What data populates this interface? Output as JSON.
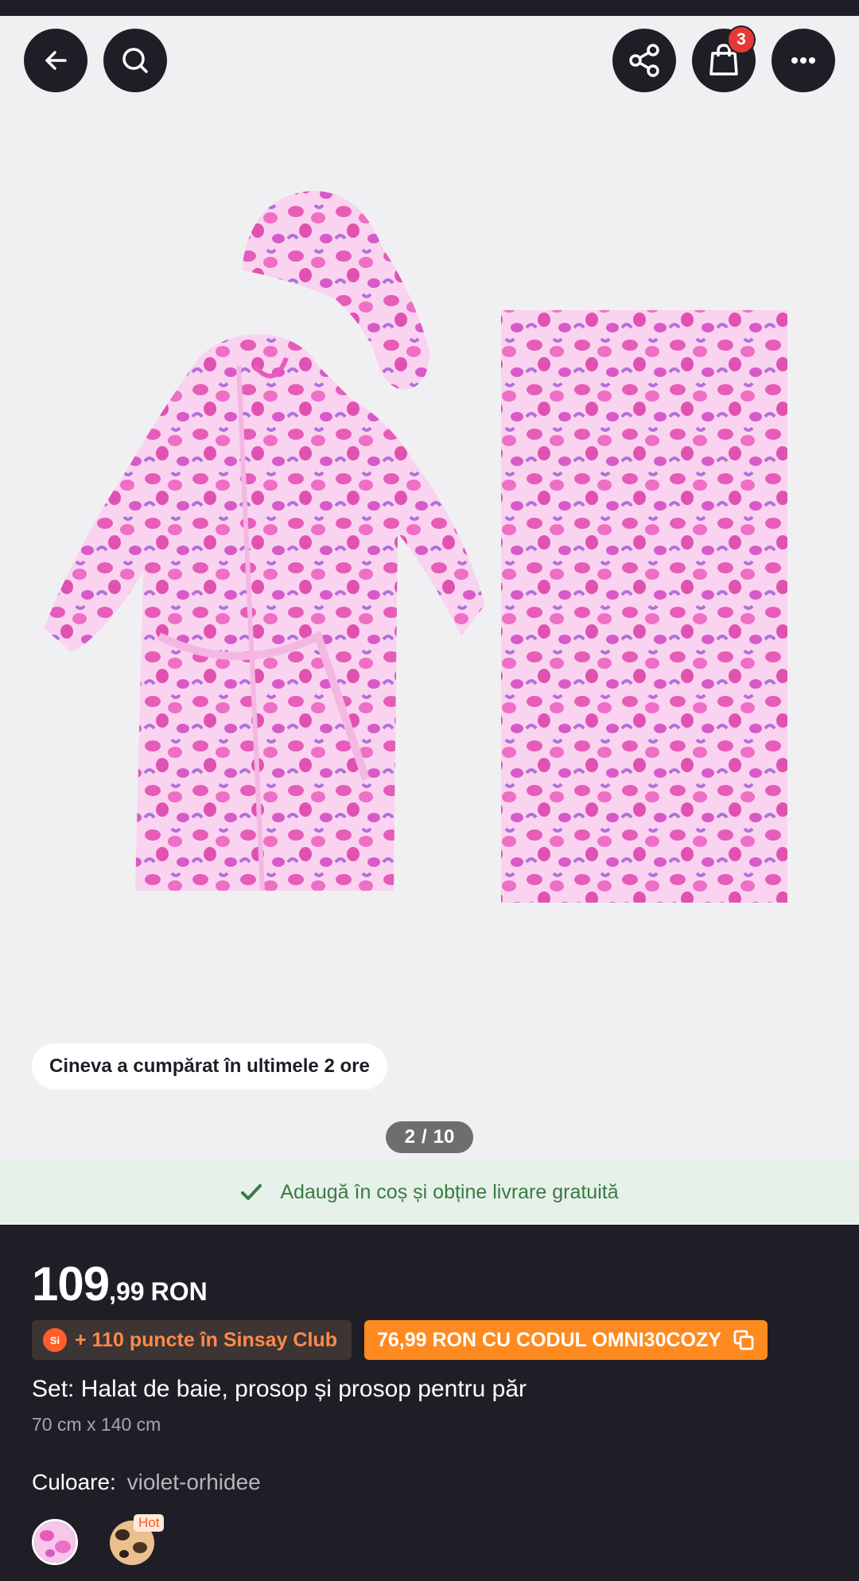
{
  "header": {
    "back_icon": "arrow-left-icon",
    "search_icon": "search-icon",
    "share_icon": "share-icon",
    "cart_icon": "shopping-bag-icon",
    "cart_count": "3",
    "more_icon": "more-horizontal-icon"
  },
  "gallery": {
    "social_proof": "Cineva a cumpărat în ultimele 2 ore",
    "current": "2",
    "separator": "/",
    "total": "10"
  },
  "promo": {
    "icon": "check-icon",
    "text": "Adaugă în coș și obține livrare gratuită"
  },
  "product": {
    "price_int": "109",
    "price_dec": ",99",
    "currency": "RON",
    "club_logo_text": "Si",
    "club_points": "+ 110 puncte în Sinsay Club",
    "promo_code_text": "76,99 RON CU CODUL OMNI30COZY",
    "copy_icon": "copy-icon",
    "title": "Set: Halat de baie, prosop și prosop pentru păr",
    "dimensions": "70 cm x 140 cm",
    "color_label": "Culoare:",
    "color_value": "violet-orhidee",
    "hot_label": "Hot"
  },
  "colors": {
    "dark": "#1f1e27",
    "accent_orange": "#ff8a1f",
    "promo_green": "#3b7a43",
    "pink_fabric": "#f7c6ea",
    "pink_spot": "#e85db8"
  }
}
